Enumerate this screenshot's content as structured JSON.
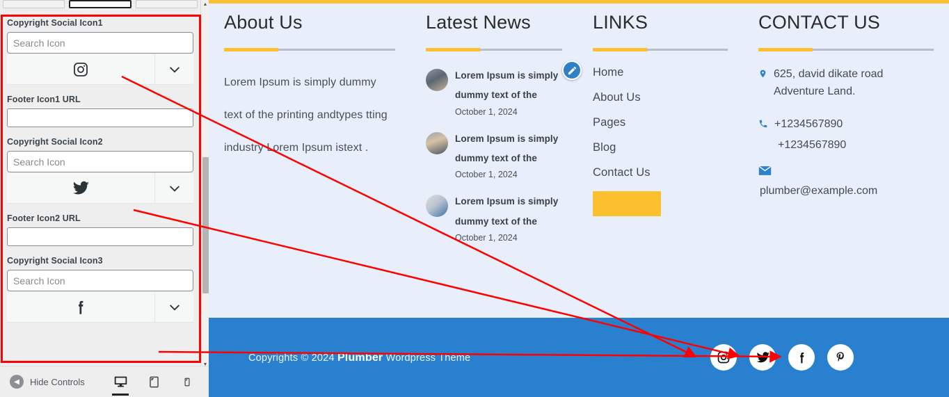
{
  "customizer": {
    "controls": [
      {
        "label": "Copyright Social Icon1",
        "search_placeholder": "Search Icon",
        "icon": "instagram-icon",
        "url_label": "Footer Icon1 URL",
        "url_value": ""
      },
      {
        "label": "Copyright Social Icon2",
        "search_placeholder": "Search Icon",
        "icon": "twitter-icon",
        "url_label": "Footer Icon2 URL",
        "url_value": ""
      },
      {
        "label": "Copyright Social Icon3",
        "search_placeholder": "Search Icon",
        "icon": "facebook-icon",
        "url_label": "",
        "url_value": ""
      }
    ],
    "bottom_bar": {
      "hide_controls_label": "Hide Controls",
      "devices": [
        "desktop-icon",
        "tablet-icon",
        "mobile-icon"
      ],
      "active_device": "desktop-icon"
    }
  },
  "preview": {
    "columns": {
      "about": {
        "title": "About Us",
        "text": "Lorem Ipsum is simply dummy text of the printing andtypes tting industry Lorem Ipsum istext ."
      },
      "news": {
        "title": "Latest News",
        "items": [
          {
            "title": "Lorem Ipsum is simply dummy text of the",
            "date": "October 1, 2024"
          },
          {
            "title": "Lorem Ipsum is simply dummy text of the",
            "date": "October 1, 2024"
          },
          {
            "title": "Lorem Ipsum is simply dummy text of the",
            "date": "October 1, 2024"
          }
        ]
      },
      "links": {
        "title": "LINKS",
        "items": [
          "Home",
          "About Us",
          "Pages",
          "Blog",
          "Contact Us"
        ]
      },
      "contact": {
        "title": "CONTACT US",
        "address": "625, david dikate road Adventure Land.",
        "phone1": "+1234567890",
        "phone2": "+1234567890",
        "email": "plumber@example.com"
      }
    },
    "copyright": {
      "prefix": "Copyrights © 2024 ",
      "brand": "Plumber",
      "suffix": " Wordpress Theme"
    },
    "social": [
      "instagram-icon",
      "twitter-icon",
      "facebook-icon",
      "pinterest-icon"
    ]
  },
  "colors": {
    "accent_yellow": "#fbc02d",
    "footer_bg": "#e8eefa",
    "copyright_bg": "#2980ce",
    "link_blue": "#2e80c8",
    "annotation_red": "#ff0000"
  }
}
